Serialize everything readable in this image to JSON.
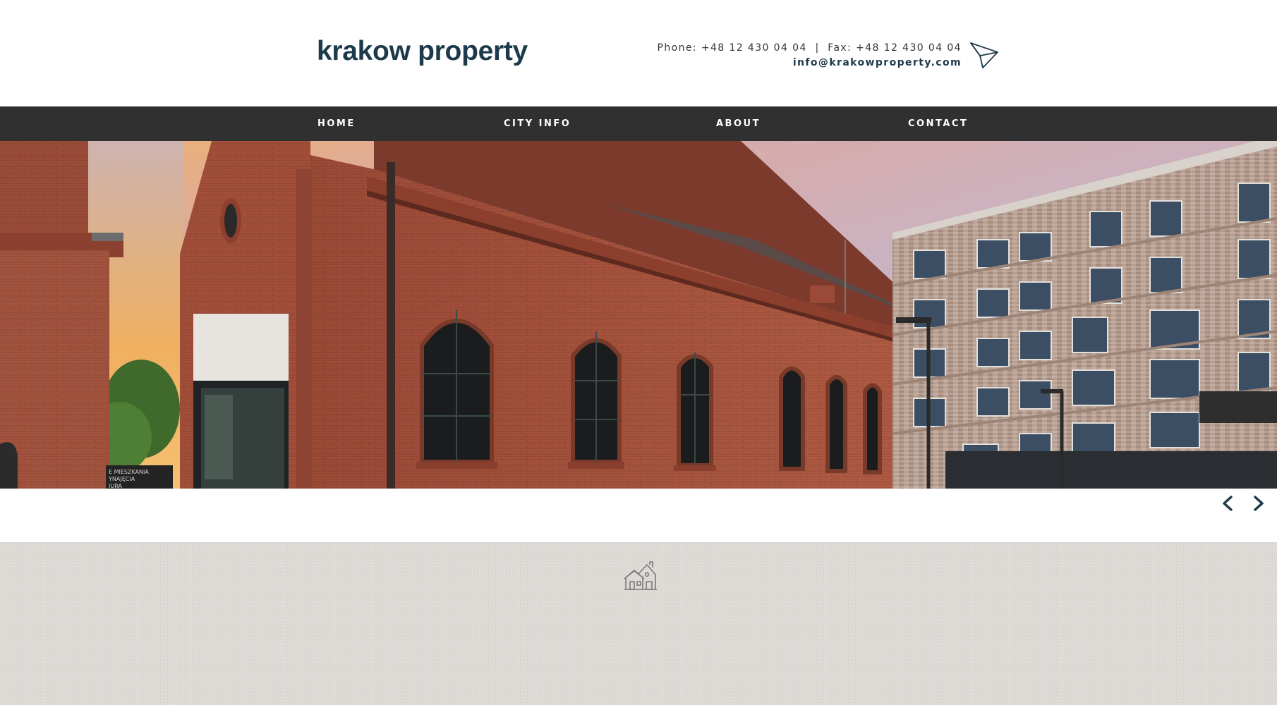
{
  "header": {
    "logo_text": "krakow property",
    "phone_line": "Phone: +48 12 430 04 04  |  Fax: +48 12 430 04 04",
    "email": "info@krakowproperty.com",
    "send_icon": "paper-plane-icon"
  },
  "nav": {
    "items": [
      {
        "label": "HOME"
      },
      {
        "label": "CITY INFO"
      },
      {
        "label": "ABOUT"
      },
      {
        "label": "CONTACT"
      }
    ],
    "background": "#303030",
    "text_color": "#ffffff"
  },
  "hero": {
    "image_alt": "Red brick historic industrial building beside modern brick apartment block at dusk",
    "sign_lines": [
      "E MIESZKANIA",
      "YNAJĘCIA",
      "IURA"
    ]
  },
  "slider": {
    "prev_icon": "chevron-left-icon",
    "next_icon": "chevron-right-icon"
  },
  "footer_band": {
    "icon": "house-icon",
    "background": "#dcd9d4"
  },
  "colors": {
    "brand": "#1d3a4b",
    "nav_bg": "#303030",
    "brick": "#a4533d",
    "footer_bg": "#dcd9d4"
  }
}
